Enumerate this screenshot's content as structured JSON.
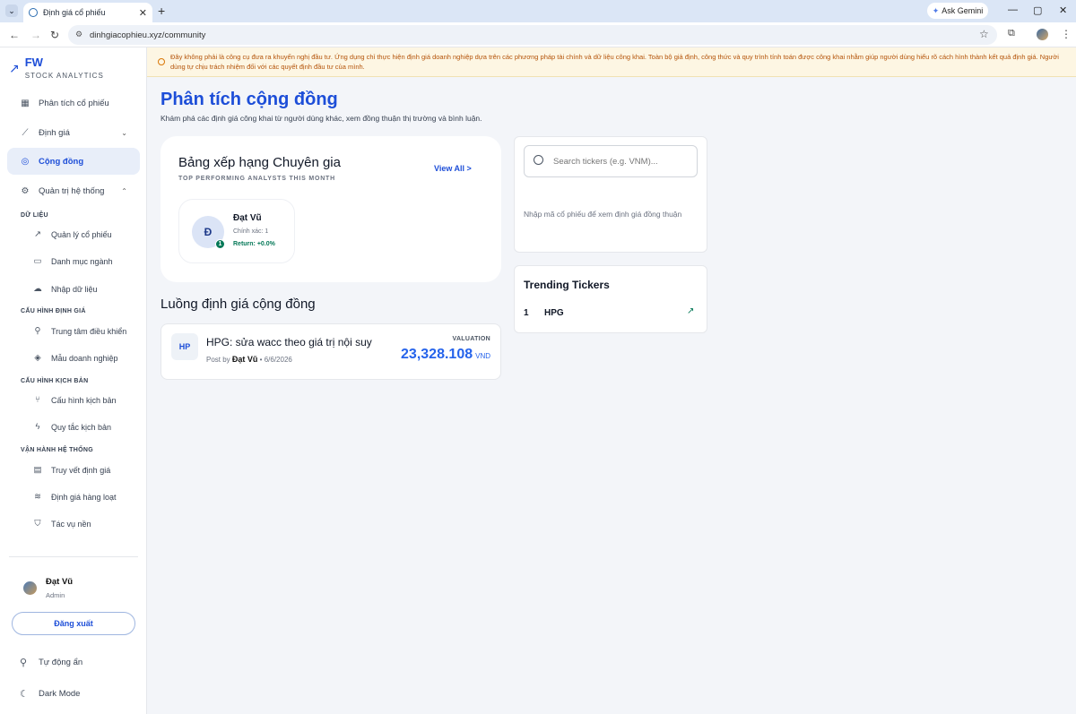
{
  "browser": {
    "tab_title": "Định giá cổ phiếu",
    "url": "dinhgiacophieu.xyz/community",
    "gemini": "Ask Gemini"
  },
  "brand": {
    "name": "FW",
    "subtitle": "STOCK ANALYTICS"
  },
  "nav": {
    "analysis": "Phân tích cổ phiếu",
    "valuation": "Định giá",
    "community": "Cộng đồng",
    "admin": "Quản trị hệ thống"
  },
  "sections": {
    "data": "DỮ LIỆU",
    "config": "CẤU HÌNH ĐỊNH GIÁ",
    "scenario": "CẤU HÌNH KỊCH BẢN",
    "ops": "VẬN HÀNH HỆ THỐNG"
  },
  "subitems": {
    "stocks": "Quản lý cổ phiếu",
    "industries": "Danh mục ngành",
    "import": "Nhập dữ liệu",
    "control": "Trung tâm điều khiển",
    "templates": "Mẫu doanh nghiệp",
    "scenario_config": "Cấu hình kịch bản",
    "rules": "Quy tắc kịch bản",
    "trace": "Truy vết định giá",
    "batch": "Định giá hàng loạt",
    "jobs": "Tác vụ nền"
  },
  "user": {
    "name": "Đạt Vũ",
    "role": "Admin",
    "logout": "Đăng xuất"
  },
  "bottom": {
    "autohide": "Tự động ẩn",
    "dark": "Dark Mode"
  },
  "notice": "Đây không phải là công cụ đưa ra khuyến nghị đầu tư. Ứng dụng chỉ thực hiện định giá doanh nghiệp dựa trên các phương pháp tài chính và dữ liệu công khai. Toàn bộ giả định, công thức và quy trình tính toán được công khai nhằm giúp người dùng hiểu rõ cách hình thành kết quả định giá. Người dùng tự chịu trách nhiệm đối với các quyết định đầu tư của mình.",
  "page": {
    "title": "Phân tích cộng đồng",
    "subtitle": "Khám phá các định giá công khai từ người dùng khác, xem đồng thuận thị trường và bình luận."
  },
  "leaderboard": {
    "title": "Bảng xếp hạng Chuyên gia",
    "subtitle": "TOP PERFORMING ANALYSTS THIS MONTH",
    "view_all": "View All >",
    "experts": [
      {
        "initial": "Đ",
        "rank": "1",
        "name": "Đạt Vũ",
        "accuracy": "Chính xác: 1",
        "return": "Return: +0.0%"
      }
    ]
  },
  "feed": {
    "title": "Luồng định giá cộng đồng",
    "items": [
      {
        "ticker": "HP",
        "title": "HPG: sửa wacc theo giá trị nội suy",
        "post_by": "Post by",
        "author": "Đạt Vũ",
        "date": "• 6/6/2026",
        "valuation_label": "VALUATION",
        "value": "23,328.108",
        "unit": "VND"
      }
    ]
  },
  "search": {
    "placeholder": "Search tickers (e.g. VNM)...",
    "hint": "Nhập mã cổ phiếu để xem định giá đồng thuận"
  },
  "trending": {
    "title": "Trending Tickers",
    "items": [
      {
        "rank": "1",
        "symbol": "HPG"
      }
    ]
  }
}
